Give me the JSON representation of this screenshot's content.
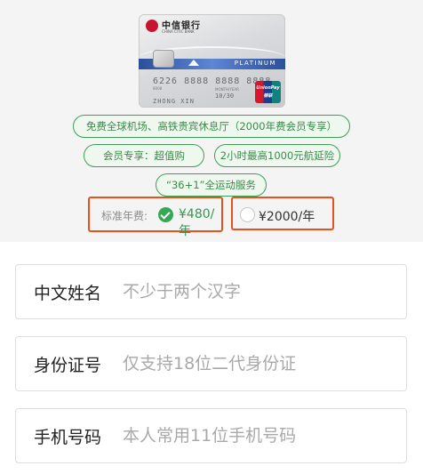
{
  "card": {
    "bank_name": "中信银行",
    "bank_en": "CHINA CITIC BANK",
    "bank_sub": "",
    "tier": "PLATINUM",
    "number": "6226 8888 8888 8888",
    "member_since": "8008",
    "valid_thru": "MONTH/YEAR",
    "expiry": "10/30",
    "holder": "ZHONG XIN",
    "network": "UnionPay 银联"
  },
  "benefits": [
    "免费全球机场、高铁贵宾休息厅（2000年费会员专享）",
    "会员专享：超值购",
    "2小时最高1000元航延险",
    "“36+1”全运动服务"
  ],
  "fee": {
    "label": "标准年费:",
    "options": [
      {
        "price": "¥480/年",
        "selected": true
      },
      {
        "price": "¥2000/年",
        "selected": false
      }
    ]
  },
  "form": {
    "name": {
      "label": "中文姓名",
      "placeholder": "不少于两个汉字"
    },
    "id_number": {
      "label": "身份证号",
      "placeholder": "仅支持18位二代身份证"
    },
    "phone": {
      "label": "手机号码",
      "placeholder": "本人常用11位手机号码"
    }
  },
  "colors": {
    "accent_green": "#34a853",
    "highlight_box": "#e2531e",
    "card_stripe": "#2c4f9a"
  }
}
